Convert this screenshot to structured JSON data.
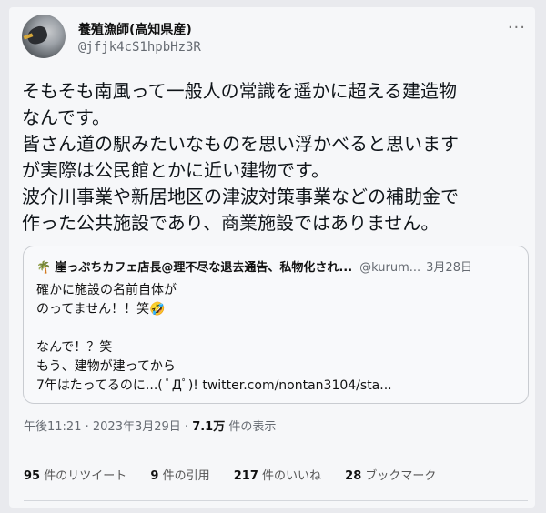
{
  "author": {
    "name": "養殖漁師(高知県産)",
    "handle": "@jfjk4cS1hpbHz3R"
  },
  "more_icon": "more-horizontal-icon",
  "tweet": {
    "lines": [
      "そもそも南風って一般人の常識を遥かに超える建造物",
      "なんです。",
      "皆さん道の駅みたいなものを思い浮かべると思います",
      "が実際は公民館とかに近い建物です。",
      "波介川事業や新居地区の津波対策事業などの補助金で",
      "作った公共施設であり、商業施設ではありません。"
    ]
  },
  "quote": {
    "icon": "🌴",
    "name": "崖っぷちカフェ店長@理不尽な退去通告、私物化され...",
    "handle": "@kurum...",
    "date": "3月28日",
    "lines": [
      "確かに施設の名前自体が",
      "のってません！！笑🤣",
      "",
      "なんで！？笑",
      "もう、建物が建ってから",
      "7年はたってるのに...( ﾟДﾟ)! twitter.com/nontan3104/sta..."
    ]
  },
  "meta": {
    "time": "午後11:21",
    "date": "2023年3月29日",
    "views": "7.1万",
    "views_label": "件の表示"
  },
  "stats": {
    "retweets": "95",
    "retweets_label": "件のリツイート",
    "quotes": "9",
    "quotes_label": "件の引用",
    "likes": "217",
    "likes_label": "件のいいね",
    "bookmarks": "28",
    "bookmarks_label": "ブックマーク"
  }
}
